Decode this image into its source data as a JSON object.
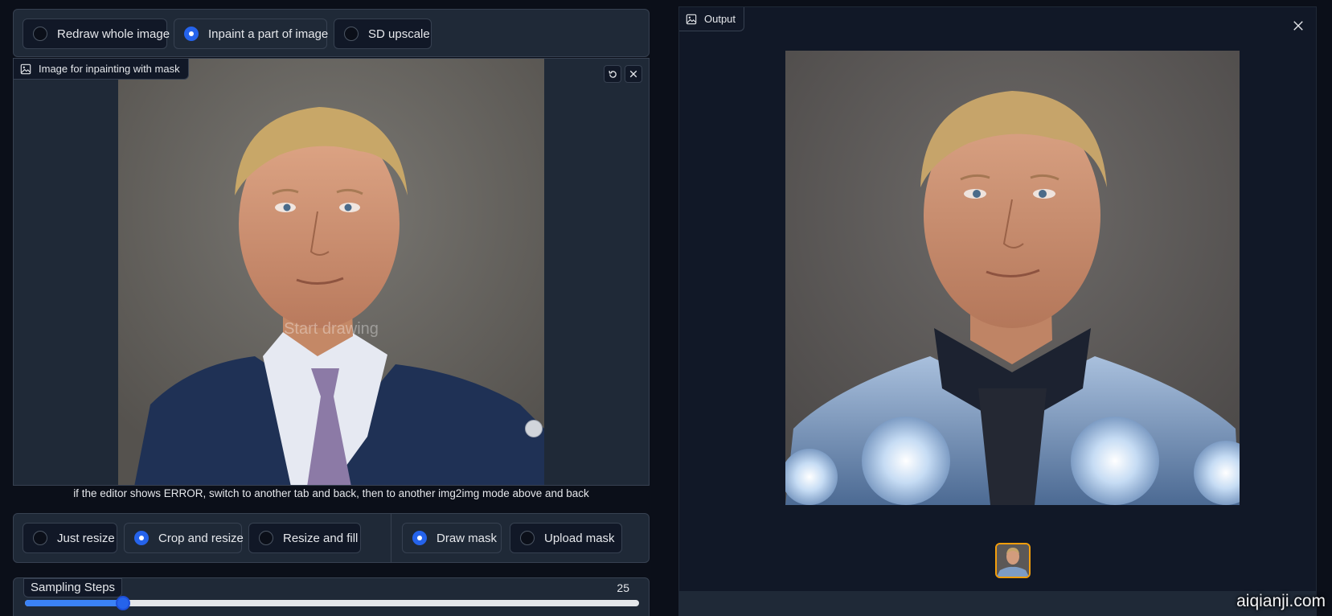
{
  "mode_tabs": [
    {
      "label": "Redraw whole image",
      "selected": false
    },
    {
      "label": "Inpaint a part of image",
      "selected": true
    },
    {
      "label": "SD upscale",
      "selected": false
    }
  ],
  "editor": {
    "label": "Image for inpainting with mask",
    "overlay_text": "Start drawing",
    "icons": [
      "undo-icon",
      "clear-icon"
    ]
  },
  "hint": "if the editor shows ERROR, switch to another tab and back, then to another img2img mode above and back",
  "resize_modes": [
    {
      "label": "Just resize",
      "selected": false
    },
    {
      "label": "Crop and resize",
      "selected": true
    },
    {
      "label": "Resize and fill",
      "selected": false
    }
  ],
  "mask_modes": [
    {
      "label": "Draw mask",
      "selected": true
    },
    {
      "label": "Upload mask",
      "selected": false
    }
  ],
  "sampling": {
    "label": "Sampling Steps",
    "value": "25",
    "fraction": 0.16
  },
  "output": {
    "label": "Output",
    "close_icon": "close-icon"
  },
  "watermark": "aiqianji.com",
  "colors": {
    "accent": "#2563eb",
    "panel": "#1f2937",
    "background": "#0b0f19",
    "thumb_border": "#f59e0b"
  }
}
